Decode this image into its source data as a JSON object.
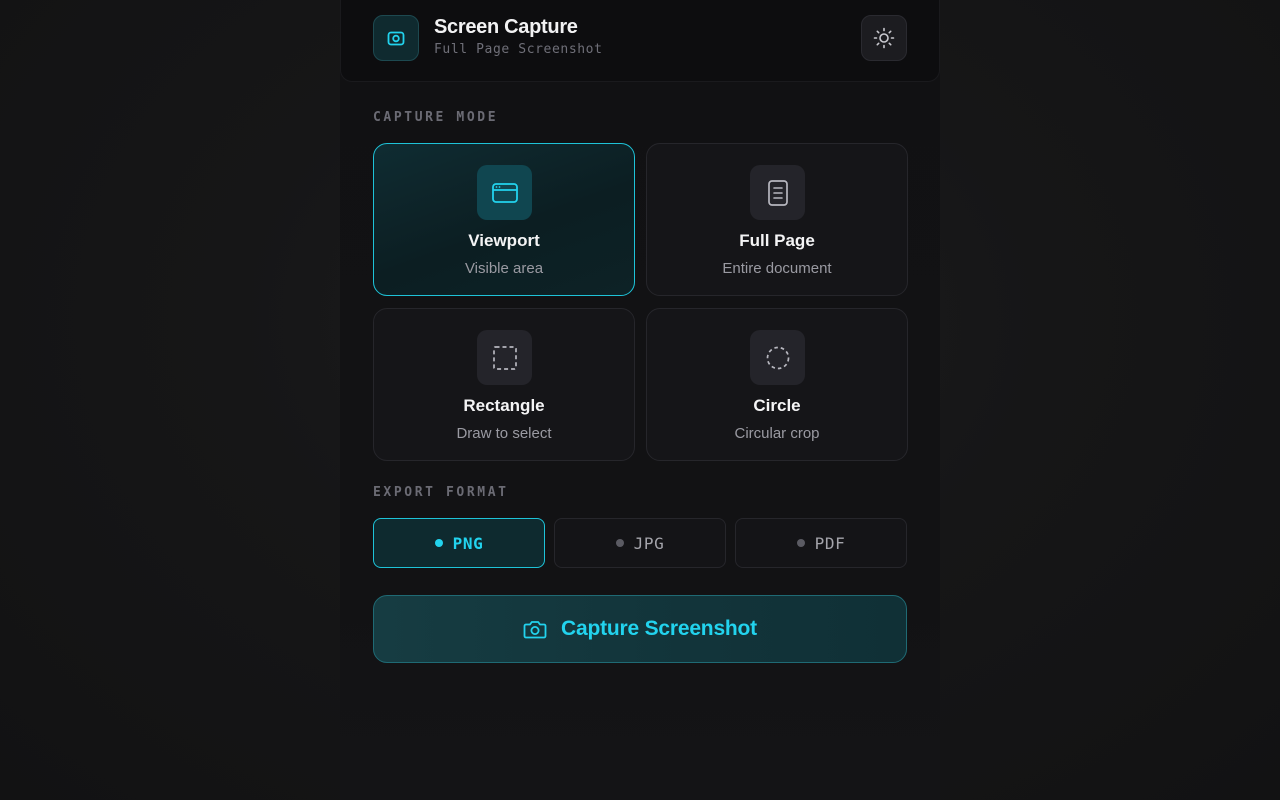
{
  "header": {
    "app_icon": "camera-icon",
    "title": "Screen Capture",
    "subtitle": "Full Page Screenshot",
    "settings_icon": "sun-icon"
  },
  "capture_mode": {
    "label": "CAPTURE MODE",
    "selected": "Viewport",
    "modes": [
      {
        "title": "Viewport",
        "desc": "Visible area",
        "icon": "browser-window-icon",
        "active": true
      },
      {
        "title": "Full Page",
        "desc": "Entire document",
        "icon": "document-icon",
        "active": false
      },
      {
        "title": "Rectangle",
        "desc": "Draw to select",
        "icon": "dashed-rectangle-icon",
        "active": false
      },
      {
        "title": "Circle",
        "desc": "Circular crop",
        "icon": "dashed-circle-icon",
        "active": false
      }
    ]
  },
  "export_format": {
    "label": "EXPORT FORMAT",
    "selected": "PNG",
    "options": [
      {
        "label": "PNG",
        "active": true
      },
      {
        "label": "JPG",
        "active": false
      },
      {
        "label": "PDF",
        "active": false
      }
    ]
  },
  "capture_button": {
    "label": "Capture Screenshot",
    "icon": "camera-icon"
  },
  "colors": {
    "accent": "#22d3ee",
    "background": "#161617",
    "card": "#151518"
  }
}
